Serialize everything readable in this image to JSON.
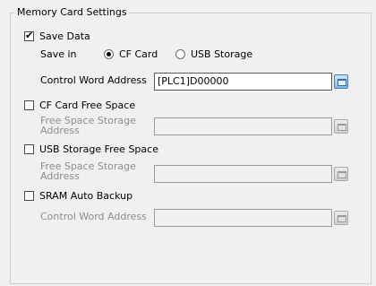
{
  "group": {
    "title": "Memory Card Settings"
  },
  "save_data": {
    "label": "Save Data",
    "checked": true
  },
  "save_in": {
    "label": "Save in",
    "options": [
      {
        "label": "CF Card",
        "selected": true
      },
      {
        "label": "USB Storage",
        "selected": false
      }
    ]
  },
  "control_word": {
    "label": "Control Word Address",
    "value": "[PLC1]D00000"
  },
  "cf_free": {
    "label": "CF Card Free Space",
    "checked": false,
    "storage_label_line1": "Free Space Storage",
    "storage_label_line2": "Address",
    "value": ""
  },
  "usb_free": {
    "label": "USB Storage Free Space",
    "checked": false,
    "storage_label_line1": "Free Space Storage",
    "storage_label_line2": "Address",
    "value": ""
  },
  "sram_backup": {
    "label": "SRAM Auto Backup",
    "checked": false,
    "control_label": "Control Word Address",
    "value": ""
  },
  "icons": {
    "address_button": "keypad-icon"
  }
}
